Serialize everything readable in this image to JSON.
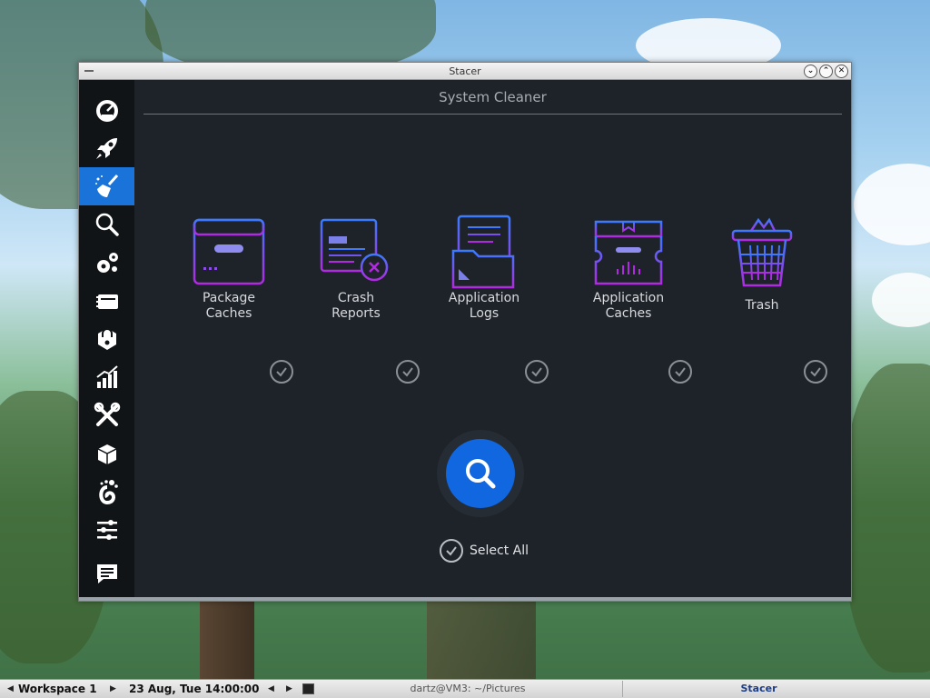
{
  "window": {
    "title": "Stacer"
  },
  "page": {
    "title": "System Cleaner"
  },
  "sidebar": {
    "items": [
      {
        "icon": "dashboard-icon",
        "active": false
      },
      {
        "icon": "startup-rocket-icon",
        "active": false
      },
      {
        "icon": "cleaner-broom-icon",
        "active": true
      },
      {
        "icon": "search-icon",
        "active": false
      },
      {
        "icon": "services-gears-icon",
        "active": false
      },
      {
        "icon": "processes-icon",
        "active": false
      },
      {
        "icon": "uninstaller-icon",
        "active": false
      },
      {
        "icon": "resources-chart-icon",
        "active": false
      },
      {
        "icon": "helpers-tools-icon",
        "active": false
      },
      {
        "icon": "apt-repository-icon",
        "active": false
      },
      {
        "icon": "gnome-settings-icon",
        "active": false
      },
      {
        "icon": "settings-sliders-icon",
        "active": false
      },
      {
        "icon": "feedback-icon",
        "active": false
      }
    ]
  },
  "categories": [
    {
      "line1": "Package",
      "line2": "Caches",
      "icon": "package-caches-icon",
      "checked": true
    },
    {
      "line1": "Crash",
      "line2": "Reports",
      "icon": "crash-reports-icon",
      "checked": true
    },
    {
      "line1": "Application",
      "line2": "Logs",
      "icon": "application-logs-icon",
      "checked": true
    },
    {
      "line1": "Application",
      "line2": "Caches",
      "icon": "application-caches-icon",
      "checked": true
    },
    {
      "line1": "Trash",
      "line2": "",
      "icon": "trash-icon",
      "checked": true
    }
  ],
  "select_all": {
    "label": "Select All",
    "checked": true
  },
  "taskbar": {
    "workspace": "Workspace 1",
    "datetime": "23 Aug, Tue 14:00:00",
    "terminal_task": "dartz@VM3: ~/Pictures",
    "active_task": "Stacer"
  },
  "colors": {
    "accent": "#1167e0",
    "sidebar_active": "#1a73d9",
    "window_bg": "#1e2329",
    "icon_gradient_start": "#3a7bff",
    "icon_gradient_end": "#b02be0"
  }
}
